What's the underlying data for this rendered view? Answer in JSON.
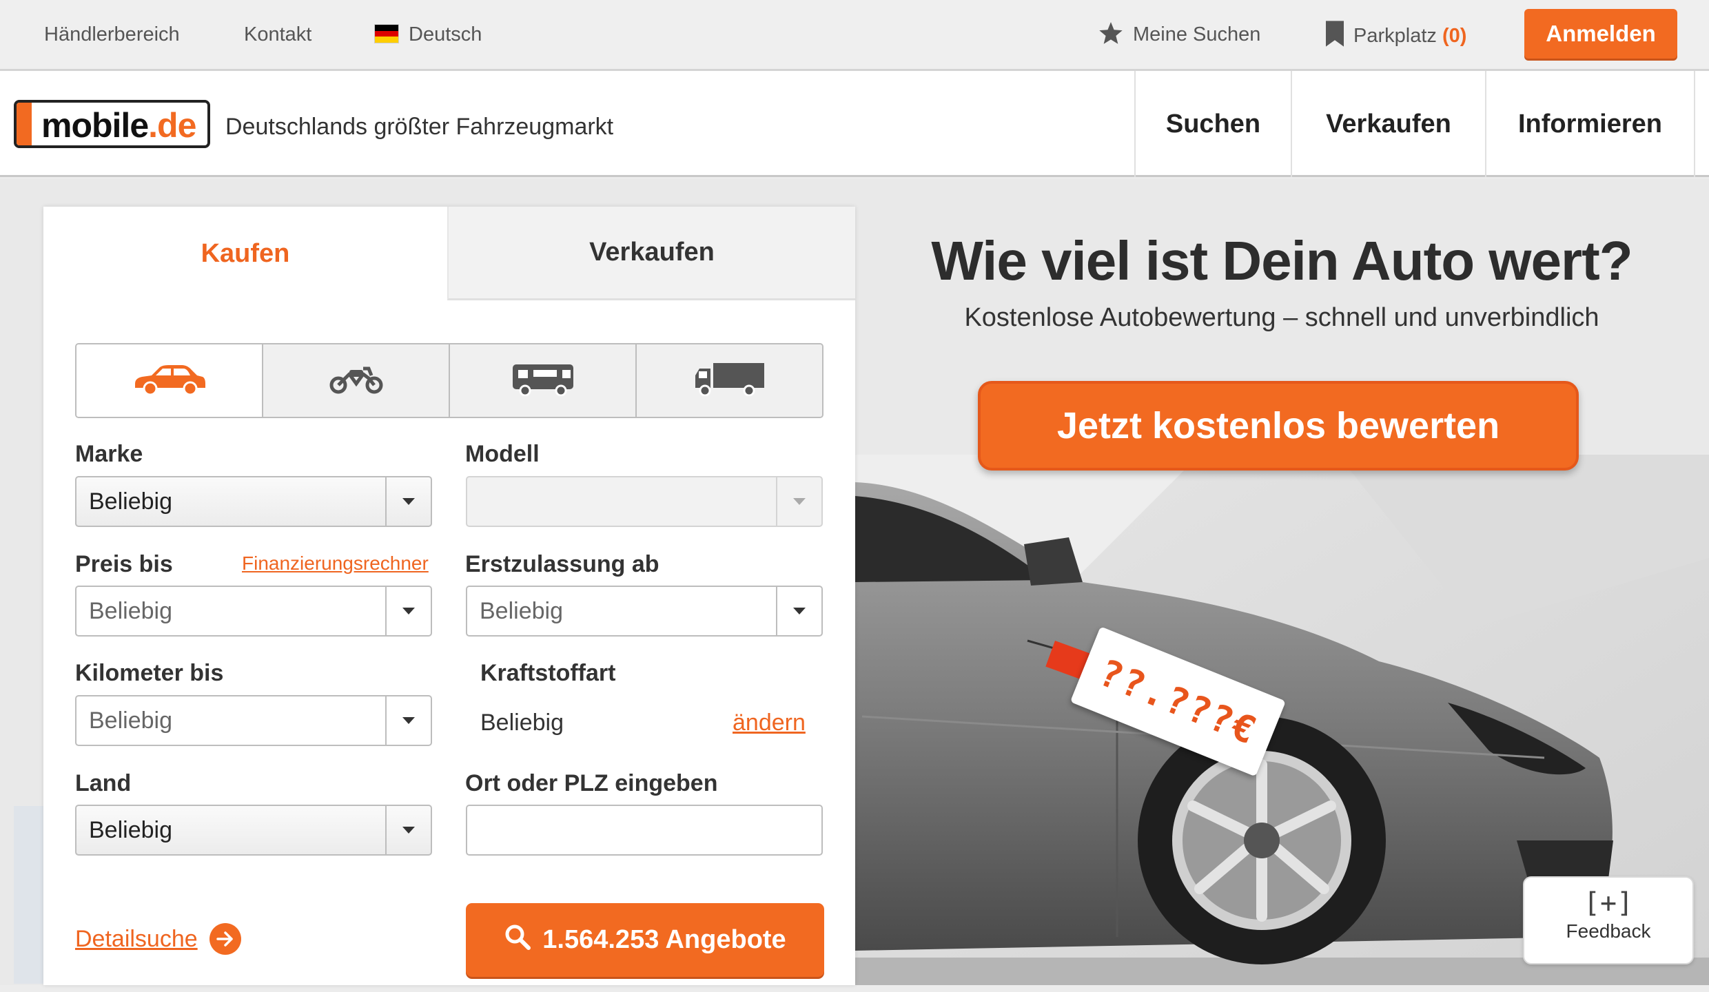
{
  "topbar": {
    "haendler": "Händlerbereich",
    "kontakt": "Kontakt",
    "language": "Deutsch",
    "meine_suchen": "Meine Suchen",
    "parkplatz": "Parkplatz",
    "parkplatz_count": "(0)",
    "anmelden": "Anmelden"
  },
  "header": {
    "logo_main": "mobile",
    "logo_tld": ".de",
    "tagline": "Deutschlands größter Fahrzeugmarkt",
    "nav": {
      "suchen": "Suchen",
      "verkaufen": "Verkaufen",
      "informieren": "Informieren"
    }
  },
  "search": {
    "tabs": {
      "kaufen": "Kaufen",
      "verkaufen": "Verkaufen"
    },
    "vehicle_types": [
      "car-icon",
      "motorbike-icon",
      "motorhome-icon",
      "truck-icon"
    ],
    "marke": {
      "label": "Marke",
      "value": "Beliebig"
    },
    "modell": {
      "label": "Modell",
      "value": ""
    },
    "preis": {
      "label": "Preis bis",
      "value": "Beliebig",
      "link": "Finanzierungsrechner"
    },
    "erstzulassung": {
      "label": "Erstzulassung ab",
      "value": "Beliebig"
    },
    "kilometer": {
      "label": "Kilometer bis",
      "value": "Beliebig"
    },
    "kraftstoff": {
      "label": "Kraftstoffart",
      "value": "Beliebig",
      "link": "ändern"
    },
    "land": {
      "label": "Land",
      "value": "Beliebig"
    },
    "ort": {
      "label": "Ort oder PLZ eingeben",
      "value": ""
    },
    "detailsuche": "Detailsuche",
    "button": "1.564.253 Angebote"
  },
  "promo": {
    "title": "Wie viel ist Dein Auto wert?",
    "subtitle": "Kostenlose Autobewertung – schnell und unverbindlich",
    "button": "Jetzt kostenlos bewerten",
    "price_tag": "??.???€"
  },
  "feedback": {
    "icon": "[+]",
    "label": "Feedback"
  },
  "colors": {
    "accent": "#f26a21",
    "text": "#333333"
  }
}
